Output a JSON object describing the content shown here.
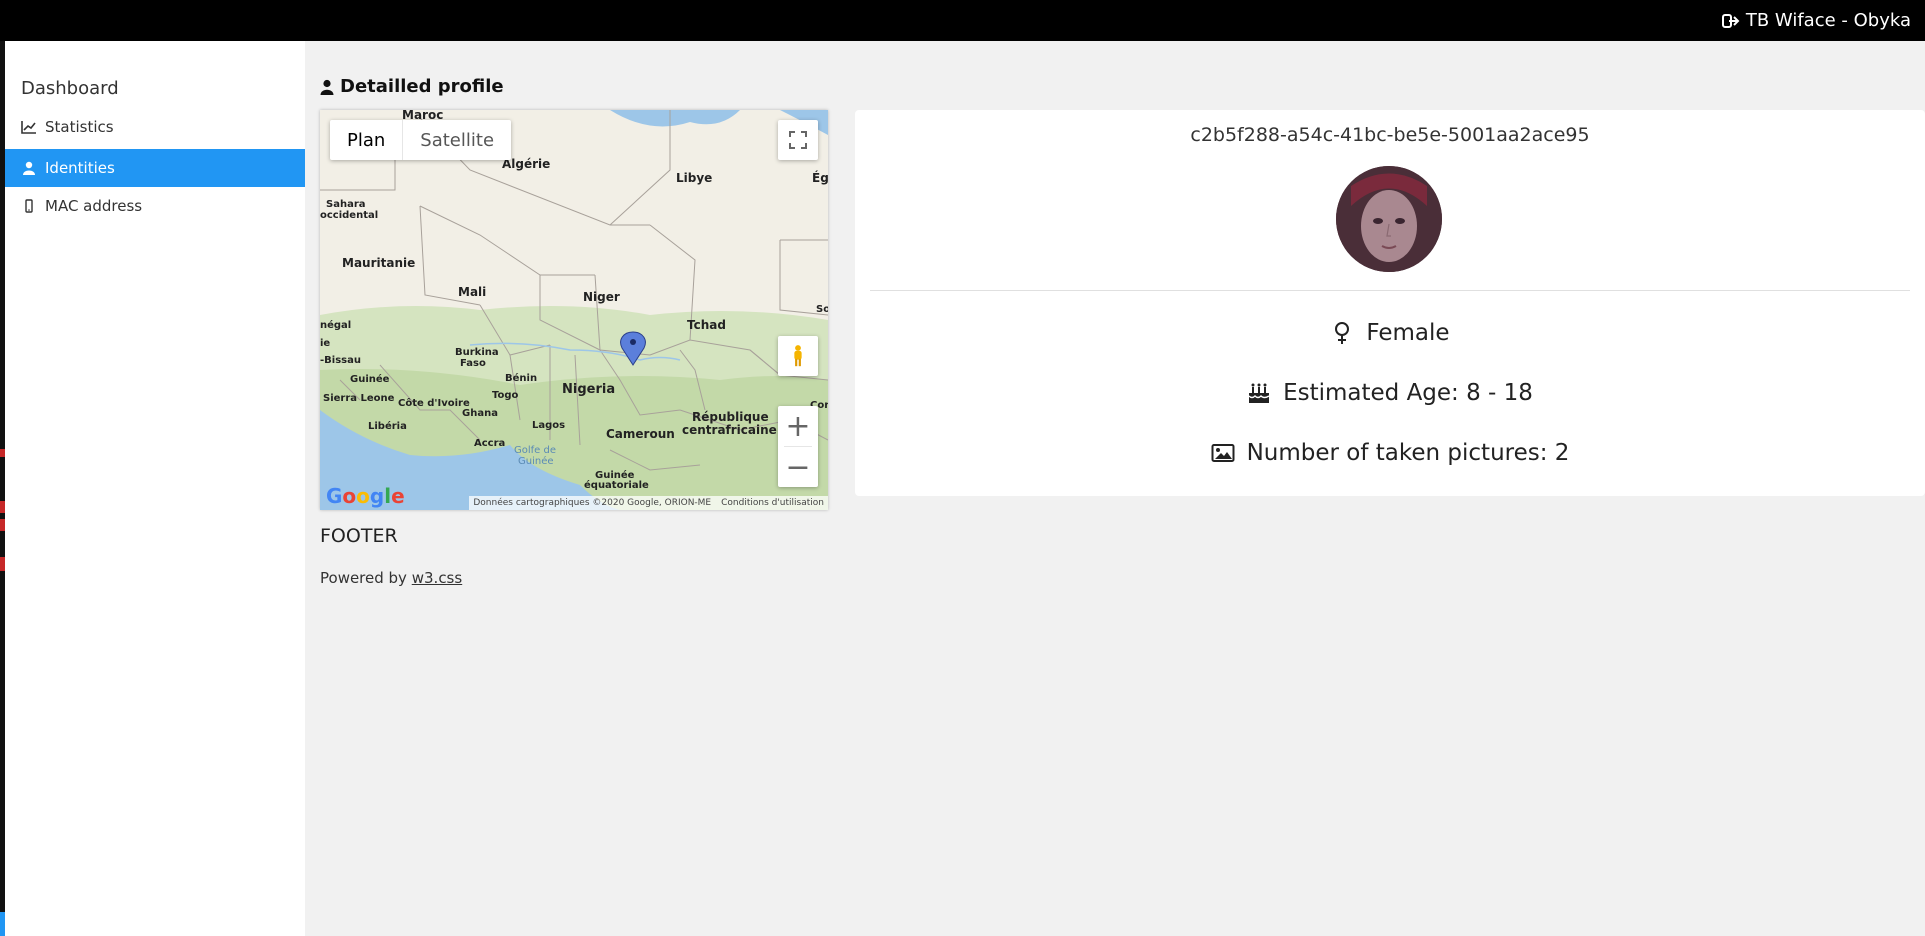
{
  "topbar": {
    "user_label": "TB Wiface - Obyka"
  },
  "sidebar": {
    "title": "Dashboard",
    "items": [
      {
        "label": "Statistics",
        "icon": "chart-line-icon",
        "active": false
      },
      {
        "label": "Identities",
        "icon": "user-icon",
        "active": true
      },
      {
        "label": "MAC address",
        "icon": "mobile-icon",
        "active": false
      }
    ]
  },
  "main": {
    "title": "Detailled profile"
  },
  "map": {
    "type_options": [
      "Plan",
      "Satellite"
    ],
    "selected_type": "Plan",
    "labels": {
      "maroc": "Maroc",
      "algerie": "Algérie",
      "libye": "Libye",
      "egypte": "Ég",
      "sahara": "Sahara",
      "occidental": "occidental",
      "mauritanie": "Mauritanie",
      "mali": "Mali",
      "niger": "Niger",
      "tchad": "Tchad",
      "soudan": "So",
      "senegal": "négal",
      "bissau": "-Bissau",
      "burkina": "Burkina",
      "faso": "Faso",
      "benin": "Bénin",
      "guinee": "Guinée",
      "sierra": "Sierra Leone",
      "cote": "Côte d'Ivoire",
      "togo": "Togo",
      "nigeria": "Nigeria",
      "ghana": "Ghana",
      "lagos": "Lagos",
      "liberia": "Libéria",
      "accra": "Accra",
      "golfe": "Golfe de",
      "golfe2": "Guinée",
      "cameroun": "Cameroun",
      "rca1": "République",
      "rca2": "centrafricaine",
      "gq1": "Guinée",
      "gq2": "équatoriale",
      "congo": "Cor",
      "ie": "ie"
    },
    "google_logo": "Google",
    "attribution": "Données cartographiques ©2020 Google, ORION-ME",
    "terms": "Conditions d'utilisation",
    "marker_color": "#5b7fdb"
  },
  "profile": {
    "id": "c2b5f288-a54c-41bc-be5e-5001aa2ace95",
    "gender": "Female",
    "age": "Estimated Age: 8 - 18",
    "pictures": "Number of taken pictures: 2"
  },
  "footer": {
    "heading": "FOOTER",
    "powered_prefix": "Powered by",
    "link": "w3.css"
  },
  "colors": {
    "accent": "#2196F3",
    "topbar": "#000000",
    "background": "#f1f1f1"
  }
}
